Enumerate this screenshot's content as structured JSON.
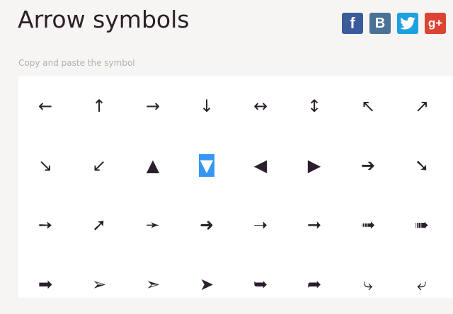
{
  "page": {
    "title": "Arrow symbols",
    "subtitle": "Copy and paste the symbol"
  },
  "social": [
    {
      "name": "facebook",
      "label": "f",
      "color": "#3b5b9a"
    },
    {
      "name": "vk",
      "label": "B",
      "color": "#4b7197"
    },
    {
      "name": "twitter",
      "label": "",
      "color": "#1da1e0"
    },
    {
      "name": "google-plus",
      "label": "g+",
      "color": "#dd4332"
    }
  ],
  "grid": {
    "selected_symbol": "▼",
    "accent_color": "#3596f6",
    "rows": [
      [
        "←",
        "↑",
        "→",
        "↓",
        "↔",
        "↕",
        "↖",
        "↗"
      ],
      [
        "↘",
        "↙",
        "▲",
        "▼",
        "◀",
        "▶",
        "➔",
        "➘"
      ],
      [
        "➙",
        "➚",
        "➛",
        "➜",
        "➝",
        "➞",
        "➟",
        "➠"
      ],
      [
        "➡",
        "➢",
        "➣",
        "➤",
        "➥",
        "➦",
        "⤷",
        "⤶"
      ]
    ]
  }
}
